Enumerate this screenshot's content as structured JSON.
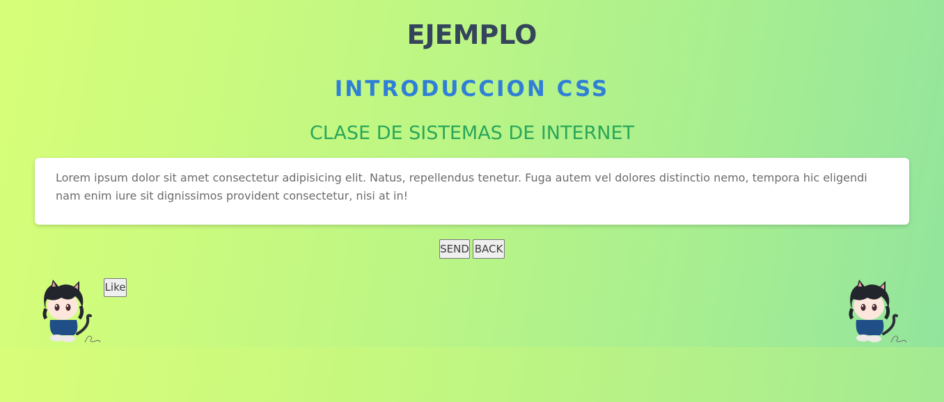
{
  "header": {
    "title": "EJEMPLO",
    "subtitle": "INTRODUCCION CSS",
    "course": "CLASE DE SISTEMAS DE INTERNET"
  },
  "card": {
    "text": "Lorem ipsum dolor sit amet consectetur adipisicing elit. Natus, repellendus tenetur. Fuga autem vel dolores distinctio nemo, tempora hic eligendi nam enim iure sit dignissimos provident consectetur, nisi at in!"
  },
  "actions": {
    "send_label": "SEND",
    "back_label": "BACK"
  },
  "like": {
    "label": "Like"
  },
  "images": {
    "left": "chibi-cat-character",
    "right": "chibi-cat-character"
  },
  "colors": {
    "title": "#34445a",
    "subtitle": "#2f7fd6",
    "course": "#2aa65a",
    "gradient_start": "#d7fe78",
    "gradient_end": "#92e49d"
  }
}
